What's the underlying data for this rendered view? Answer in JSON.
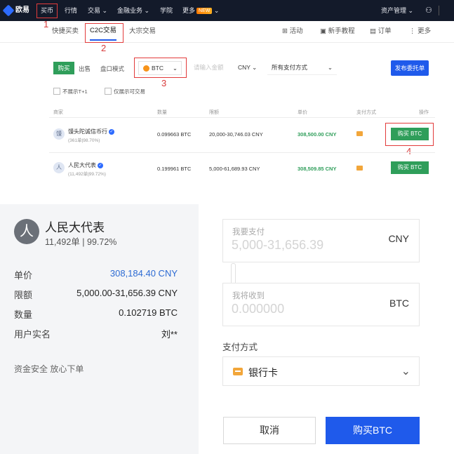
{
  "topnav": {
    "brand": "欧易",
    "items": [
      "买币",
      "行情",
      "交易",
      "金融业务",
      "学院",
      "更多"
    ],
    "new_badge": "NEW",
    "asset_mgmt": "资产管理"
  },
  "subnav": {
    "tabs": [
      "快捷买卖",
      "C2C交易",
      "大宗交易"
    ],
    "right": [
      "活动",
      "新手教程",
      "订单",
      "更多"
    ]
  },
  "annotations": [
    "1",
    "2",
    "3",
    "4"
  ],
  "filters": {
    "buy": "购买",
    "sell": "出售",
    "mode": "盘口模式",
    "coin": "BTC",
    "amount_placeholder": "请输入金额",
    "fiat": "CNY",
    "payment": "所有支付方式",
    "post_ad": "发布委托单",
    "hide_t1": "不展示T+1",
    "tradable_only": "仅展示可交易"
  },
  "table": {
    "headers": [
      "商家",
      "数量",
      "限额",
      "单价",
      "支付方式",
      "操作"
    ],
    "rows": [
      {
        "avatar": "馒",
        "name": "馒头陀诚信币行",
        "stats": "(361单|98.70%)",
        "qty": "0.099663 BTC",
        "limit": "20,000-30,746.03 CNY",
        "price": "308,500.00 CNY",
        "action": "购买 BTC"
      },
      {
        "avatar": "人",
        "name": "人民大代表",
        "stats": "(11,492单|99.72%)",
        "qty": "0.199961 BTC",
        "limit": "5,000-61,689.93 CNY",
        "price": "308,509.85 CNY",
        "action": "购买 BTC"
      }
    ]
  },
  "detail": {
    "avatar": "人",
    "name": "人民大代表",
    "stats": "11,492单 | 99.72%",
    "labels": [
      "单价",
      "限额",
      "数量",
      "用户实名"
    ],
    "price": "308,184.40 CNY",
    "limit": "5,000.00-31,656.39 CNY",
    "qty": "0.102719 BTC",
    "realname": "刘**",
    "safety": "资金安全 放心下单"
  },
  "order": {
    "pay_label": "我要支付",
    "pay_placeholder": "5,000-31,656.39",
    "pay_unit": "CNY",
    "receive_label": "我将收到",
    "receive_placeholder": "0.000000",
    "receive_unit": "BTC",
    "payment_method_label": "支付方式",
    "payment_method": "银行卡",
    "cancel": "取消",
    "confirm": "购买BTC"
  },
  "colors": {
    "nav_bg": "#131a2a",
    "accent_blue": "#1f5aeb",
    "buy_green": "#2f9e5a",
    "highlight_red": "#e23b3b",
    "price_blue": "#2d6bd3"
  }
}
